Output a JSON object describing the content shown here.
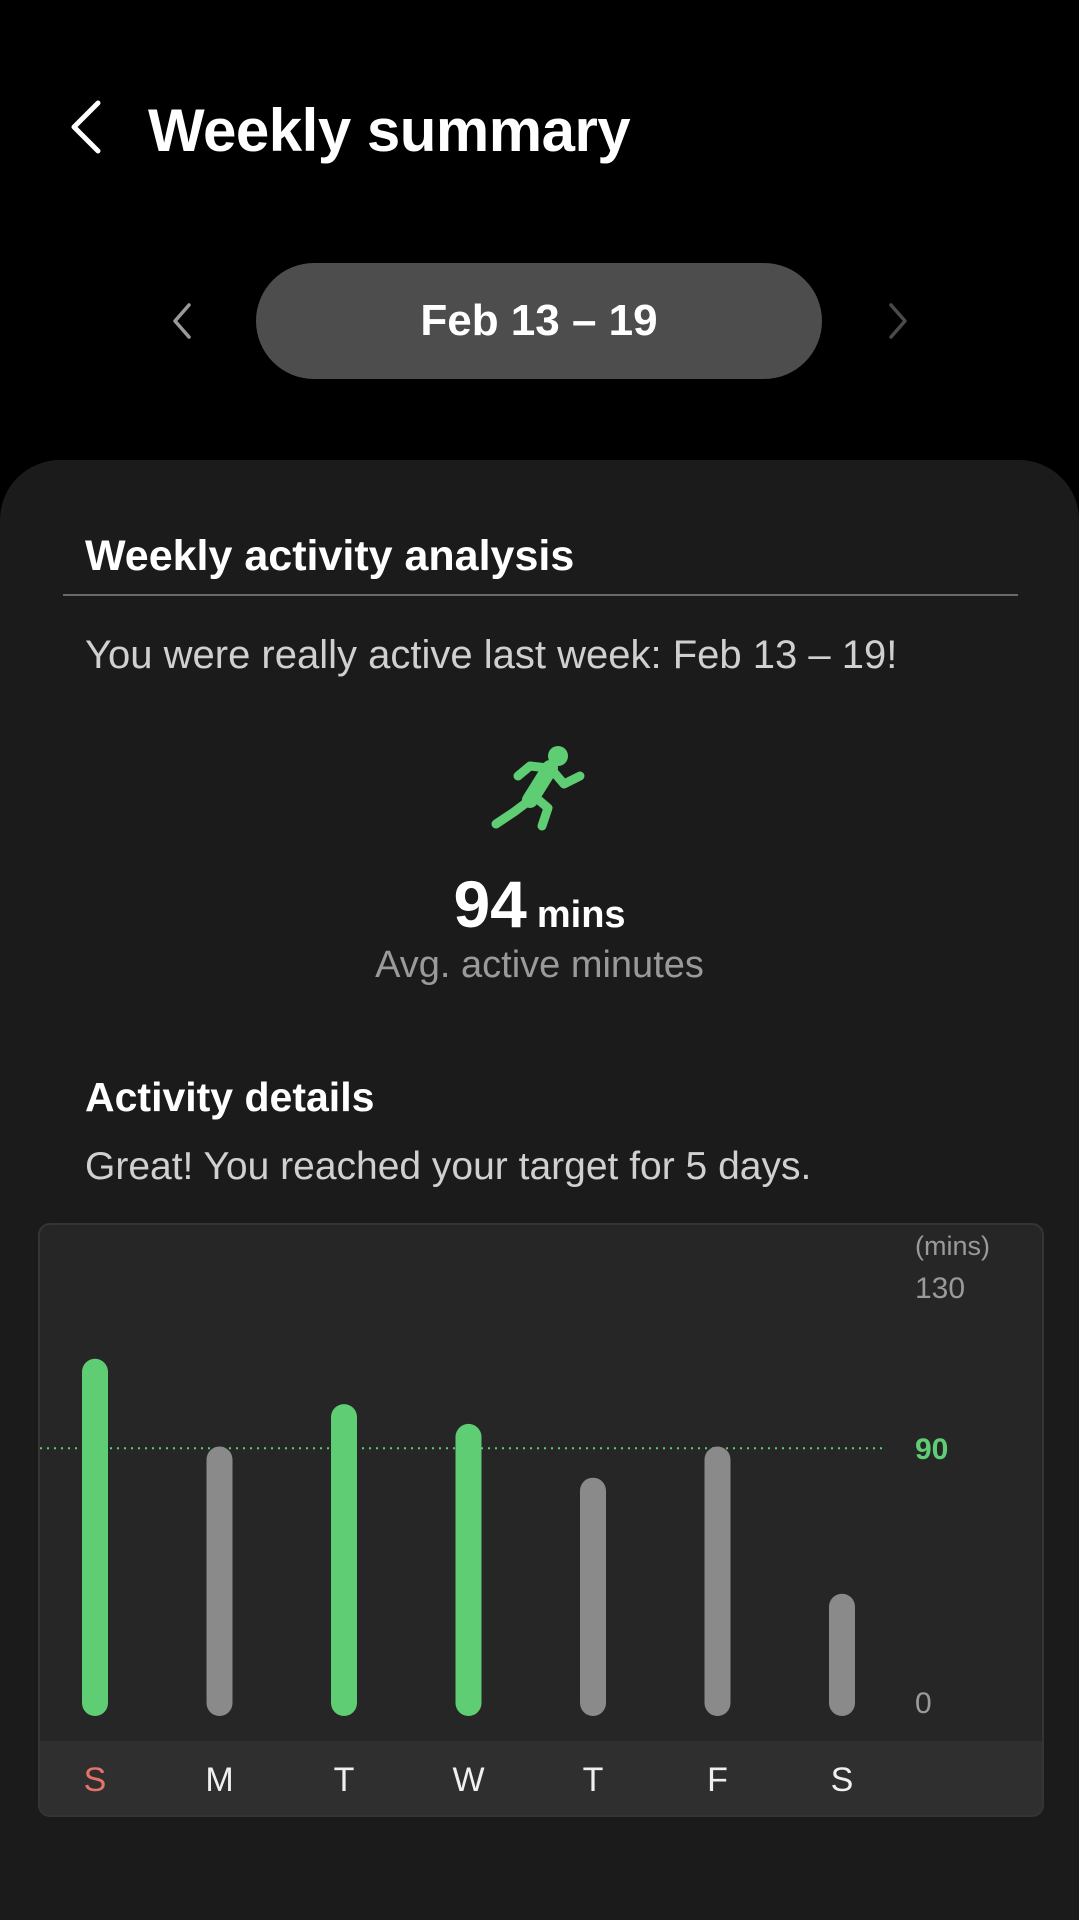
{
  "header": {
    "title": "Weekly summary",
    "back_icon": "chevron-left-icon"
  },
  "date_nav": {
    "range_label": "Feb 13 – 19",
    "prev_icon": "chevron-left-icon",
    "next_icon": "chevron-right-icon"
  },
  "analysis": {
    "title": "Weekly activity analysis",
    "summary": "You were really active last week: Feb 13 – 19!",
    "icon": "running-person-icon",
    "avg_value": "94",
    "avg_unit": "mins",
    "avg_label": "Avg. active minutes"
  },
  "details": {
    "title": "Activity details",
    "text": "Great! You reached your target for 5 days."
  },
  "colors": {
    "accent_green": "#5fcd74",
    "below_target_gray": "#8a8a8a",
    "sunday_red": "#e57368"
  },
  "chart_data": {
    "type": "bar",
    "categories": [
      "S",
      "M",
      "T",
      "W",
      "T",
      "F",
      "S"
    ],
    "values": [
      117,
      86,
      101,
      94,
      75,
      86,
      34
    ],
    "target": 90,
    "unit_label": "(mins)",
    "ylim": [
      0,
      130
    ],
    "y_tick_labels": [
      "130",
      "90",
      "0"
    ]
  }
}
